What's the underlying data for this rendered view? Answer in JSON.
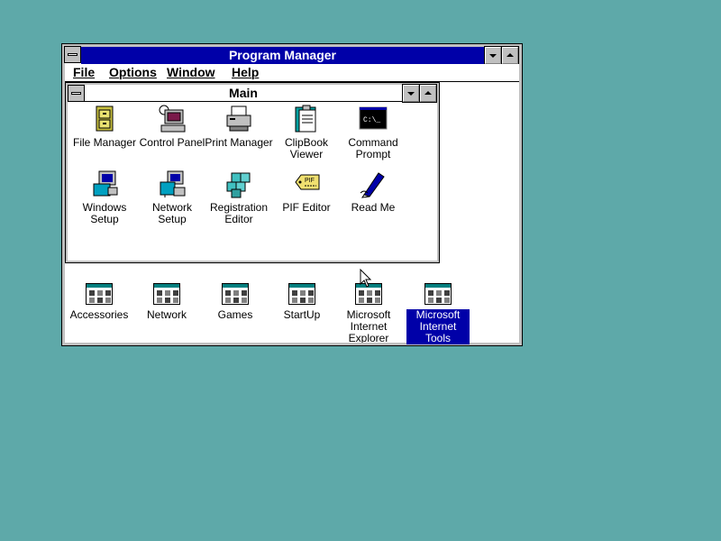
{
  "program_manager": {
    "title": "Program Manager",
    "menu": [
      "File",
      "Options",
      "Window",
      "Help"
    ]
  },
  "main_window": {
    "title": "Main",
    "icons": [
      {
        "label": "File Manager",
        "icon": "file-cabinet-icon"
      },
      {
        "label": "Control Panel",
        "icon": "control-panel-icon"
      },
      {
        "label": "Print Manager",
        "icon": "printer-icon"
      },
      {
        "label": "ClipBook Viewer",
        "icon": "clipbook-icon"
      },
      {
        "label": "Command Prompt",
        "icon": "terminal-icon",
        "glyph_text": "C:\\_"
      },
      {
        "label": "Windows Setup",
        "icon": "setup-computer-icon"
      },
      {
        "label": "Network Setup",
        "icon": "network-setup-icon"
      },
      {
        "label": "Registration Editor",
        "icon": "registry-cubes-icon"
      },
      {
        "label": "PIF Editor",
        "icon": "pif-tag-icon",
        "glyph_text": "PIF"
      },
      {
        "label": "Read Me",
        "icon": "pen-icon"
      }
    ]
  },
  "groups": [
    {
      "label": "Accessories"
    },
    {
      "label": "Network"
    },
    {
      "label": "Games"
    },
    {
      "label": "StartUp"
    },
    {
      "label": "Microsoft Internet Explorer"
    },
    {
      "label": "Microsoft Internet Tools",
      "selected": true
    }
  ],
  "colors": {
    "desktop": "#5ea9a9",
    "titlebar_active": "#0000a8",
    "selection": "#0000a8"
  }
}
